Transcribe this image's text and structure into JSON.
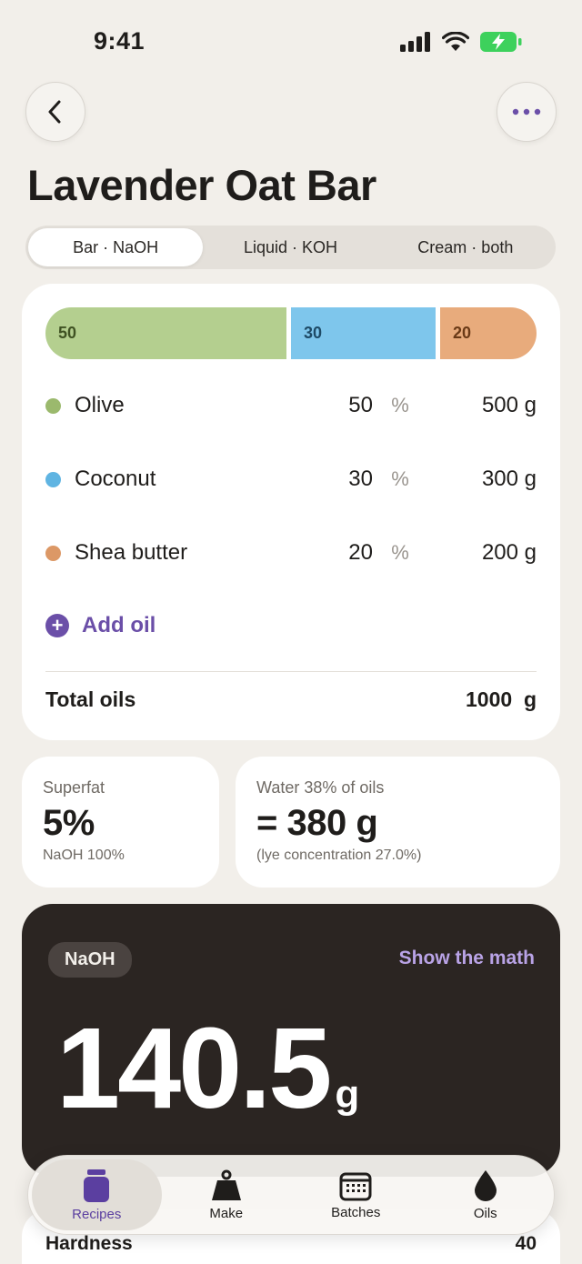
{
  "status": {
    "time": "9:41"
  },
  "header": {
    "title": "Lavender Oat Bar"
  },
  "segments": [
    {
      "label": "Bar · NaOH",
      "active": true
    },
    {
      "label": "Liquid · KOH",
      "active": false
    },
    {
      "label": "Cream · both",
      "active": false
    }
  ],
  "ratio": [
    {
      "value": "50",
      "fraction": 50,
      "color": "#b4cf8f",
      "text_color": "#3f5223"
    },
    {
      "value": "30",
      "fraction": 30,
      "color": "#7ec6ec",
      "text_color": "#1e4a66"
    },
    {
      "value": "20",
      "fraction": 20,
      "color": "#e8ab7c",
      "text_color": "#6a3a17"
    }
  ],
  "oils": [
    {
      "name": "Olive",
      "pct": "50",
      "pct_unit": "%",
      "grams": "500 g",
      "color": "#9bb96d"
    },
    {
      "name": "Coconut",
      "pct": "30",
      "pct_unit": "%",
      "grams": "300 g",
      "color": "#5fb4e2"
    },
    {
      "name": "Shea butter",
      "pct": "20",
      "pct_unit": "%",
      "grams": "200 g",
      "color": "#dc9866"
    }
  ],
  "add_oil": {
    "icon": "plus-icon",
    "label": "Add oil"
  },
  "total": {
    "label": "Total oils",
    "value": "1000  g"
  },
  "superfat": {
    "label": "Superfat",
    "value": "5%",
    "sub": "NaOH 100%"
  },
  "water": {
    "label": "Water 38% of oils",
    "value": "= 380 g",
    "sub": "(lye concentration 27.0%)"
  },
  "lye": {
    "badge": "NaOH",
    "math_link": "Show the math",
    "value": "140.5",
    "unit": "g"
  },
  "peek": {
    "label": "Hardness",
    "value": "40"
  },
  "tabs": [
    {
      "label": "Recipes",
      "icon": "jar-icon",
      "active": true
    },
    {
      "label": "Make",
      "icon": "weight-icon",
      "active": false
    },
    {
      "label": "Batches",
      "icon": "calendar-icon",
      "active": false
    },
    {
      "label": "Oils",
      "icon": "drop-icon",
      "active": false
    }
  ],
  "colors": {
    "accent": "#6b4fa8",
    "lye_card": "#2b2522",
    "background": "#f2efea"
  }
}
